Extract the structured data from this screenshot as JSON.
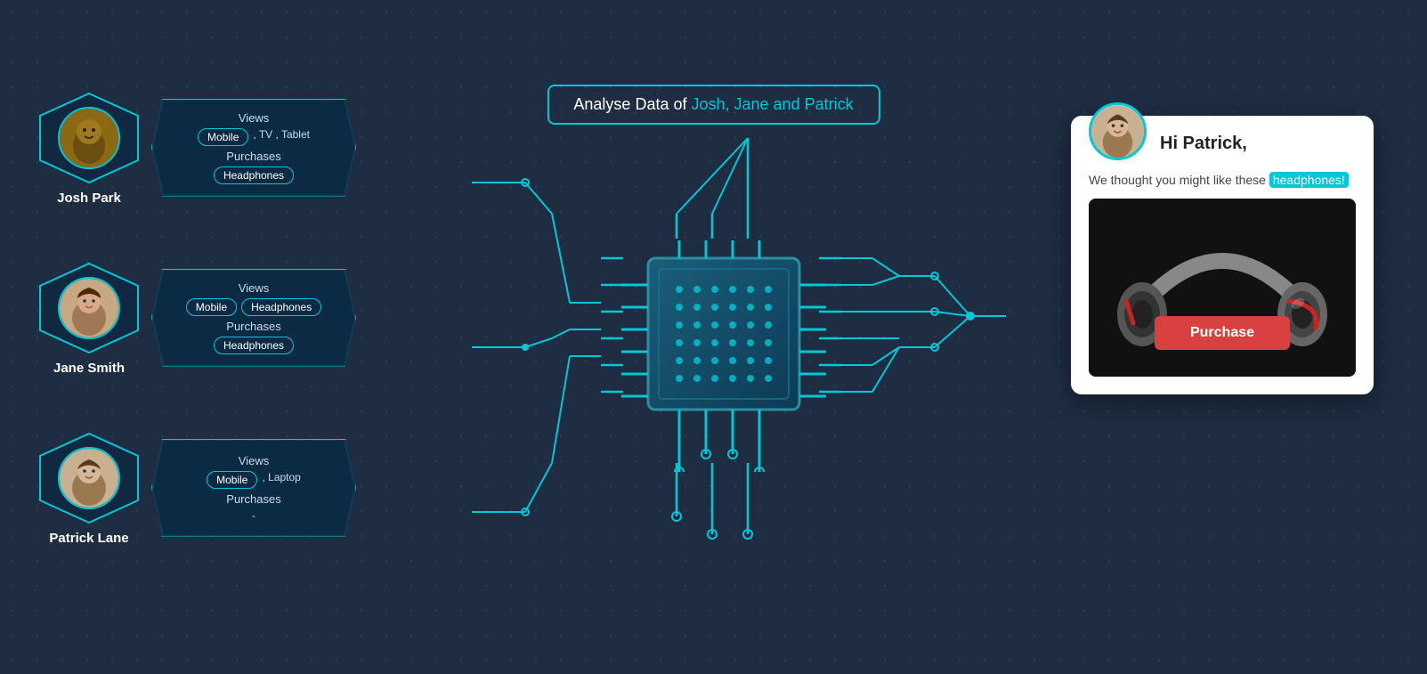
{
  "title": {
    "text": "Analyse Data of ",
    "highlight": "Josh, Jane and Patrick"
  },
  "users": [
    {
      "name": "Josh Park",
      "id": "josh",
      "emoji": "👨🏿",
      "views": {
        "label": "Views",
        "tags": [
          "Mobile"
        ],
        "plain": ", TV , Tablet"
      },
      "purchases": {
        "label": "Purchases",
        "tags": [
          "Headphones"
        ],
        "plain": ""
      }
    },
    {
      "name": "Jane Smith",
      "id": "jane",
      "emoji": "👩",
      "views": {
        "label": "Views",
        "tags": [
          "Mobile",
          "Headphones"
        ],
        "plain": ""
      },
      "purchases": {
        "label": "Purchases",
        "tags": [
          "Headphones"
        ],
        "plain": ""
      }
    },
    {
      "name": "Patrick Lane",
      "id": "patrick",
      "emoji": "👨",
      "views": {
        "label": "Views",
        "tags": [
          "Mobile"
        ],
        "plain": ", Laptop"
      },
      "purchases": {
        "label": "Purchases",
        "tags": [],
        "plain": "-"
      }
    }
  ],
  "result_card": {
    "greeting": "Hi Patrick,",
    "message_before": "We thought you might like these ",
    "message_highlight": "headphones!",
    "purchase_label": "Purchase"
  }
}
